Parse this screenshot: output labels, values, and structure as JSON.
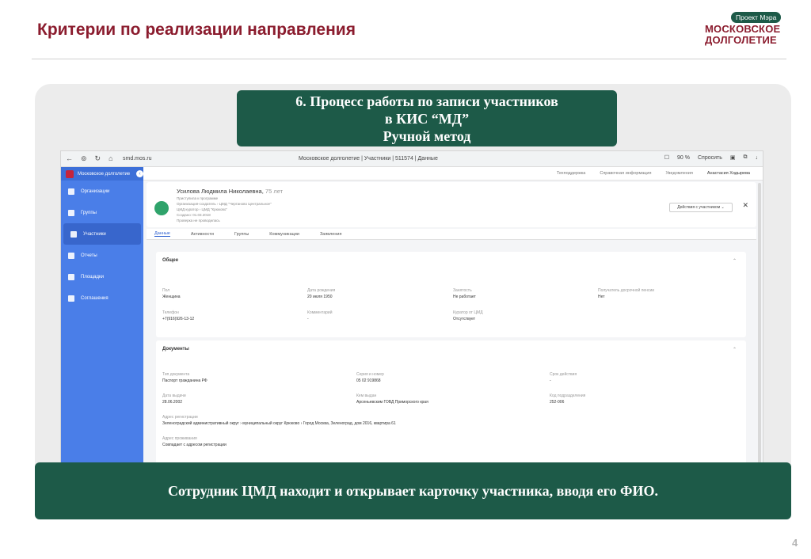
{
  "slide": {
    "title": "Критерии по реализации направления",
    "page_number": "4"
  },
  "logo": {
    "badge": "Проект Мэра",
    "line1": "МОСКОВСКОЕ",
    "line2": "ДОЛГОЛЕТИЕ"
  },
  "process_box": {
    "line1": "6. Процесс работы по записи участников",
    "line2": "в КИС “МД”",
    "line3": "Ручной метод"
  },
  "callout": "Сотрудник ЦМД находит и открывает карточку участника, вводя его ФИО.",
  "browser": {
    "url": "smd.mos.ru",
    "tab_title": "Московское долголетие | Участники | 511574 | Данные",
    "zoom": "90 %",
    "ask": "Спросить"
  },
  "sidebar": {
    "header": "Московское долголетие",
    "items": [
      {
        "label": "Организации"
      },
      {
        "label": "Группы"
      },
      {
        "label": "Участники"
      },
      {
        "label": "Отчеты"
      },
      {
        "label": "Площадки"
      },
      {
        "label": "Соглашения"
      }
    ]
  },
  "topbar": {
    "support": "Техподдержка",
    "reference": "Справочная информация",
    "notifications": "Уведомления",
    "user": "Анастасия Ходырева"
  },
  "person": {
    "name": "Усилова Людмила Николаевна,",
    "age": "75 лет",
    "line_sub": "Приступила к программе",
    "org": "Организация-создатель  ›  ЦМД \"Чертаново Центральное\"",
    "curator": "ЦМД куратор  ›  ЦМД \"Крюково\"",
    "created": "Создано: 01.03.2018",
    "check": "Проверка не проводилась"
  },
  "actions_label": "Действия с участником",
  "tabs": [
    "Данные",
    "Активности",
    "Группы",
    "Коммуникации",
    "Заявления"
  ],
  "general": {
    "title": "Общее",
    "fields": [
      {
        "label": "Пол",
        "value": "Женщина"
      },
      {
        "label": "Дата рождения",
        "value": "20 июля 1950"
      },
      {
        "label": "Занятость",
        "value": "Не работает"
      },
      {
        "label": "Получатель досрочной пенсии",
        "value": "Нет"
      },
      {
        "label": "Телефон",
        "value": "+7(916)926-13-12"
      },
      {
        "label": "Комментарий",
        "value": "-"
      },
      {
        "label": "Куратор от ЦМД",
        "value": "Отсутствует"
      }
    ]
  },
  "documents": {
    "title": "Документы",
    "fields": [
      {
        "label": "Тип документа",
        "value": "Паспорт гражданина РФ"
      },
      {
        "label": "Серия и номер",
        "value": "05 02 919868"
      },
      {
        "label": "Срок действия",
        "value": "-"
      },
      {
        "label": "Дата выдачи",
        "value": "28.06.2002"
      },
      {
        "label": "Кем выдан",
        "value": "Арсеньевским ГОВД Приморского края"
      },
      {
        "label": "Код подразделения",
        "value": "252-006"
      },
      {
        "label": "Адрес регистрации",
        "value": "Зеленоградский административный округ  ›  муниципальный округ Крюково  ›  Город Москва, Зеленоград, дом 2016, квартира 61"
      },
      {
        "label": "Адрес проживания",
        "value": "Совпадает с адресом регистрации"
      }
    ]
  }
}
